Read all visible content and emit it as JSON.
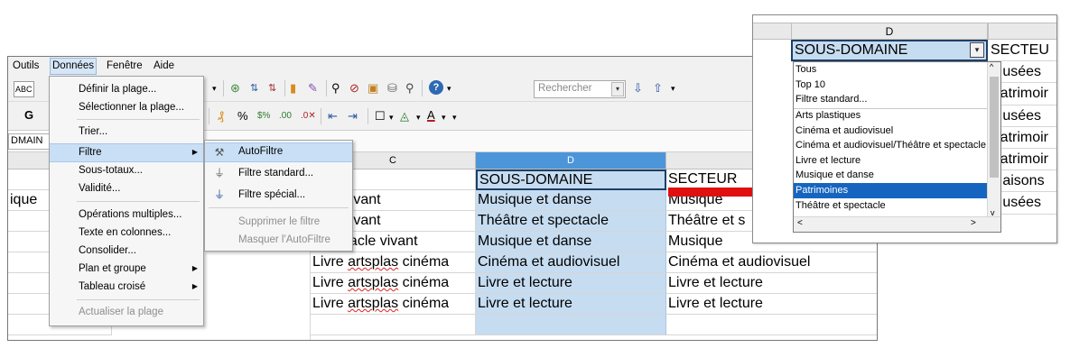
{
  "menubar": {
    "items": [
      "Outils",
      "Données",
      "Fenêtre",
      "Aide"
    ]
  },
  "toolbar": {
    "search_placeholder": "Rechercher",
    "bold_label": "G",
    "namebox_value": "DMAIN"
  },
  "donnees_menu": {
    "items": [
      {
        "label": "Définir la plage..."
      },
      {
        "label": "Sélectionner la plage..."
      },
      {
        "label": "Trier..."
      },
      {
        "label": "Filtre"
      },
      {
        "label": "Sous-totaux..."
      },
      {
        "label": "Validité..."
      },
      {
        "label": "Opérations multiples..."
      },
      {
        "label": "Texte en colonnes..."
      },
      {
        "label": "Consolider..."
      },
      {
        "label": "Plan et groupe"
      },
      {
        "label": "Tableau croisé"
      },
      {
        "label": "Actualiser la plage"
      }
    ]
  },
  "filtre_submenu": {
    "items": [
      {
        "label": "AutoFiltre"
      },
      {
        "label": "Filtre standard..."
      },
      {
        "label": "Filtre spécial..."
      },
      {
        "label": "Supprimer le filtre"
      },
      {
        "label": "Masquer l'AutoFiltre"
      }
    ]
  },
  "grid": {
    "col_headers": [
      "C",
      "D"
    ],
    "left_fragment": "ique",
    "rows": [
      {
        "c": "AINE",
        "d": "SOUS-DOMAINE",
        "e": "SECTEUR"
      },
      {
        "c": "acle vivant",
        "d": "Musique et danse",
        "e": "Musique"
      },
      {
        "c": "acle vivant",
        "d": "Théâtre et spectacle",
        "e": "Théâtre et s"
      },
      {
        "c": "Spectacle vivant",
        "d": "Musique et danse",
        "e": "Musique"
      },
      {
        "c": "Livre artsplas cinéma",
        "d": "Cinéma et audiovisuel",
        "e": "Cinéma et audiovisuel"
      },
      {
        "c": "Livre artsplas cinéma",
        "d": "Livre et lecture",
        "e": "Livre et lecture"
      },
      {
        "c": "Livre artsplas cinéma",
        "d": "Livre et lecture",
        "e": "Livre et lecture"
      }
    ]
  },
  "inset": {
    "col_header": "D",
    "header_cell": "SOUS-DOMAINE",
    "right_col": [
      "SECTEU",
      "Musées",
      "Patrimoir",
      "Musées",
      "Patrimoir",
      "Patrimoir",
      "Maisons",
      "Musées"
    ],
    "dropdown": {
      "items": [
        "Tous",
        "Top 10",
        "Filtre standard...",
        "Arts plastiques",
        "Cinéma et audiovisuel",
        "Cinéma et audiovisuel/Théâtre et spectacle",
        "Livre et lecture",
        "Musique et danse",
        "Patrimoines",
        "Théâtre et spectacle"
      ],
      "selected": "Patrimoines"
    }
  },
  "colors": {
    "selection": "#c6dcf1",
    "highlight": "#1565c0",
    "arrow": "#e01010"
  }
}
